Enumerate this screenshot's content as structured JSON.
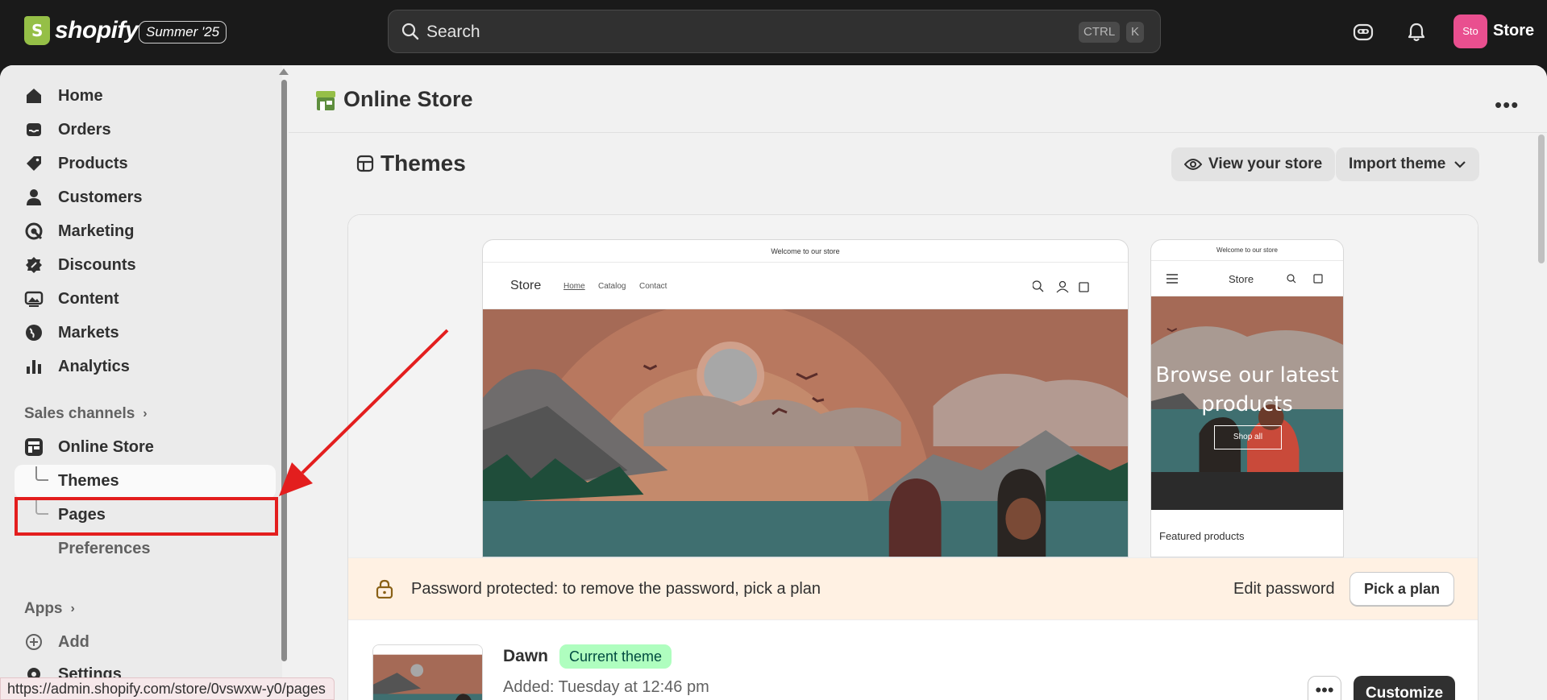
{
  "topbar": {
    "logo_text": "shopify",
    "edition": "Summer '25",
    "search_placeholder": "Search",
    "kbd_ctrl": "CTRL",
    "kbd_k": "K",
    "avatar_initials": "Sto",
    "store_name": "Store"
  },
  "sidebar": {
    "items": [
      {
        "label": "Home",
        "icon": "home-icon"
      },
      {
        "label": "Orders",
        "icon": "inbox-icon"
      },
      {
        "label": "Products",
        "icon": "tag-icon"
      },
      {
        "label": "Customers",
        "icon": "person-icon"
      },
      {
        "label": "Marketing",
        "icon": "target-icon"
      },
      {
        "label": "Discounts",
        "icon": "discount-icon"
      },
      {
        "label": "Content",
        "icon": "image-icon"
      },
      {
        "label": "Markets",
        "icon": "globe-icon"
      },
      {
        "label": "Analytics",
        "icon": "bar-chart-icon"
      }
    ],
    "sales_channels_label": "Sales channels",
    "online_store_label": "Online Store",
    "sub_items": [
      "Themes",
      "Pages",
      "Preferences"
    ],
    "apps_label": "Apps",
    "add_label": "Add",
    "settings_label": "Settings"
  },
  "main": {
    "page_title": "Online Store",
    "themes_title": "Themes",
    "view_store_label": "View your store",
    "import_theme_label": "Import theme",
    "preview": {
      "announcement": "Welcome to our store",
      "store_name": "Store",
      "nav_links": [
        "Home",
        "Catalog",
        "Contact"
      ],
      "mobile_heading": "Browse our latest products",
      "shop_all": "Shop all",
      "featured": "Featured products"
    },
    "password_text": "Password protected: to remove the password, pick a plan",
    "edit_password": "Edit password",
    "pick_plan": "Pick a plan",
    "theme": {
      "name": "Dawn",
      "badge": "Current theme",
      "added": "Added: Tuesday at 12:46 pm",
      "customize": "Customize"
    }
  },
  "status_url": "https://admin.shopify.com/store/0vswxw-y0/pages",
  "colors": {
    "accent_highlight": "#e31e1e",
    "badge_bg": "#affebf",
    "avatar": "#e94f8f"
  }
}
